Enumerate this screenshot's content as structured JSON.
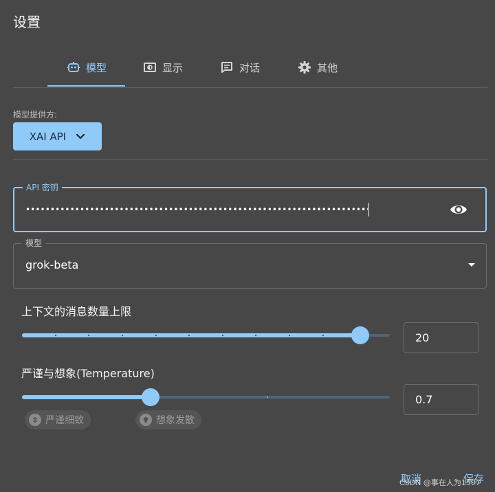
{
  "dialog": {
    "title": "设置"
  },
  "tabs": [
    {
      "label": "模型",
      "icon": "robot-icon",
      "active": true
    },
    {
      "label": "显示",
      "icon": "display-icon",
      "active": false
    },
    {
      "label": "对话",
      "icon": "chat-icon",
      "active": false
    },
    {
      "label": "其他",
      "icon": "gear-icon",
      "active": false
    }
  ],
  "provider": {
    "label": "模型提供方:",
    "value": "XAI API"
  },
  "api_key": {
    "label": "API 密钥",
    "masked_value": "••••••••••••••••••••••••••••••••••••••••••••••••••••••••••••••••••••••••••••••••••••"
  },
  "model": {
    "label": "模型",
    "value": "grok-beta"
  },
  "context_limit": {
    "label": "上下文的消息数量上限",
    "value": "20",
    "fraction": 0.92
  },
  "temperature": {
    "label": "严谨与想象(Temperature)",
    "value": "0.7",
    "fraction": 0.35,
    "chip_precise": "严谨细致",
    "chip_creative": "想象发散"
  },
  "footer": {
    "cancel_label": "取消",
    "save_label": "保存"
  },
  "watermark": "CSDN @事在人为1507",
  "colors": {
    "accent": "#90caf9",
    "background": "#474747"
  }
}
